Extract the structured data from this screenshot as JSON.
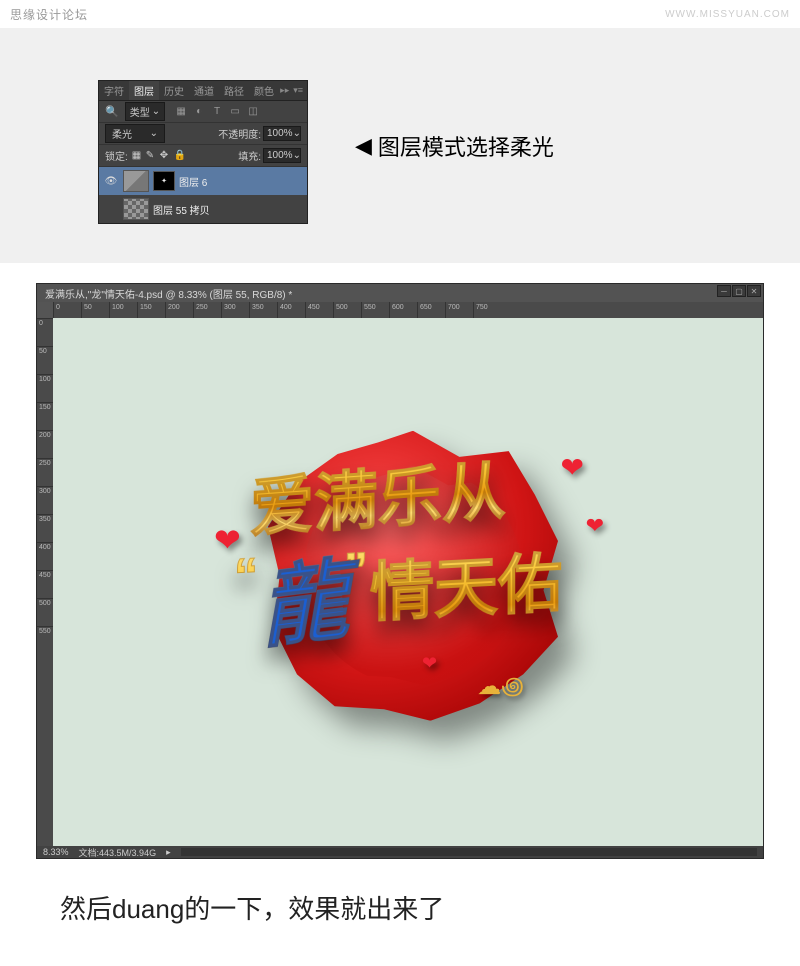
{
  "header": {
    "forum": "思缘设计论坛",
    "site": "WWW.MISSYUAN.COM"
  },
  "layers_panel": {
    "tabs": [
      "字符",
      "图层",
      "历史",
      "通道",
      "路径",
      "颜色"
    ],
    "active_tab": "图层",
    "type_label": "类型",
    "blend_mode": "柔光",
    "opacity_label": "不透明度:",
    "opacity_value": "100%",
    "lock_label": "锁定:",
    "fill_label": "填充:",
    "fill_value": "100%",
    "layer1_name": "图层 6",
    "layer2_name": "图层 55 拷贝"
  },
  "annotation": "图层模式选择柔光",
  "ps": {
    "tab_title": "爱满乐从,\"龙\"情天佑-4.psd @ 8.33% (图层 55, RGB/8) *",
    "zoom": "8.33%",
    "doc_info": "文档:443.5M/3.94G",
    "ruler_ticks": [
      "50",
      "100",
      "150",
      "200",
      "250",
      "300",
      "350",
      "400",
      "450",
      "500",
      "550",
      "600",
      "650",
      "700",
      "750"
    ],
    "v_ticks": [
      "0",
      "50",
      "100",
      "150",
      "200",
      "250",
      "300",
      "350",
      "400",
      "450",
      "500",
      "550"
    ]
  },
  "artwork": {
    "line1": "爱满乐从",
    "long": "龍",
    "line2": "情天佑"
  },
  "caption": "然后duang的一下，效果就出来了"
}
